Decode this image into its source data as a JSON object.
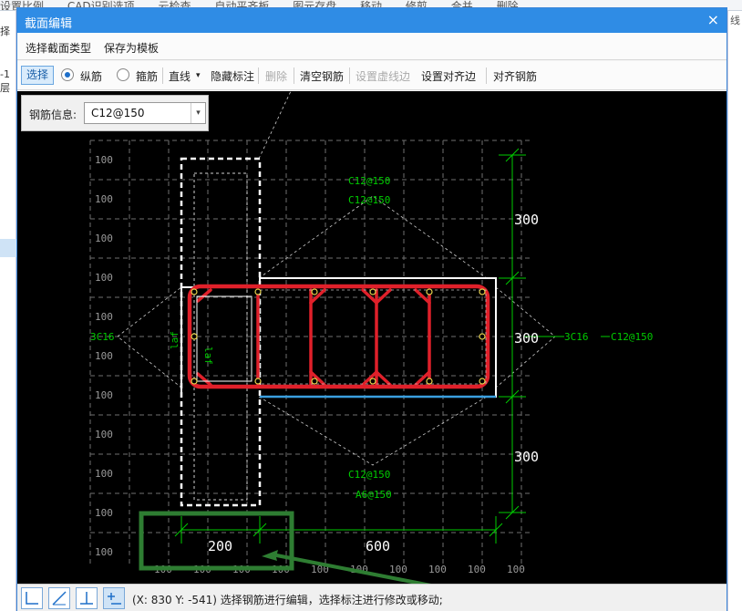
{
  "background_app": {
    "toolbar_items": [
      "设置比例",
      "CAD识别选项",
      "云检查",
      "自动平齐板",
      "图元存盘",
      "移动",
      "修剪",
      "合并",
      "删除"
    ],
    "left_labels": [
      "择",
      "-1层"
    ],
    "right_label": "线"
  },
  "dialog": {
    "title": "截面编辑",
    "close_glyph": "×"
  },
  "menu": {
    "select_section_type": "选择截面类型",
    "save_as_template": "保存为模板"
  },
  "toolbar": {
    "select": "选择",
    "longitudinal": "纵筋",
    "stirrup": "箍筋",
    "line": "直线",
    "dropdown_glyph": "▾",
    "hide_annotation": "隐藏标注",
    "delete": "删除",
    "clear_rebar": "清空钢筋",
    "set_virtual_edge": "设置虚线边",
    "set_align_edge": "设置对齐边",
    "align_rebar": "对齐钢筋",
    "mode": "longitudinal"
  },
  "rebar_info": {
    "label": "钢筋信息:",
    "value": "C12@150",
    "arrow_glyph": "▾"
  },
  "drawing": {
    "grid_label": "100",
    "dims": {
      "top_300": "300",
      "mid_300": "300",
      "bot_300": "300",
      "width_200": "200",
      "width_600": "600"
    },
    "rebar_labels": {
      "top1": "C12@150",
      "top2": "C12@150",
      "bot1": "C12@150",
      "bot2": "A6@150",
      "left_3c16": "3C16",
      "right_3c16": "3C16",
      "right_c12": "C12@150",
      "laf": "laf"
    },
    "colors": {
      "grid": "#8a8a8a",
      "dim": "#00cc00",
      "rebar": "#e0202a",
      "outline": "#ffffff",
      "edge": "#3aa0e0",
      "highlight": "#2e7d32"
    }
  },
  "status": {
    "message": "(X: 830 Y: -541) 选择钢筋进行编辑，选择标注进行修改或移动;",
    "icons": [
      "ortho-icon",
      "polar-icon",
      "perpendicular-icon",
      "snap-icon"
    ]
  }
}
